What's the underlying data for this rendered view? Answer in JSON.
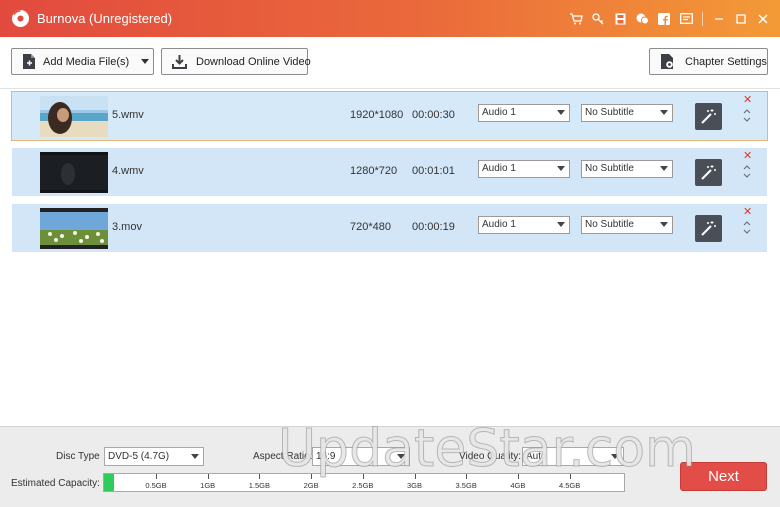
{
  "window": {
    "title": "Burnova (Unregistered)"
  },
  "titlebar_icons": [
    "cart-icon",
    "key-icon",
    "save-icon",
    "chat-icon",
    "facebook-icon",
    "feedback-icon",
    "minimize-icon",
    "maximize-icon",
    "close-icon"
  ],
  "toolbar": {
    "add_media_label": "Add Media File(s)",
    "download_label": "Download Online Video",
    "chapter_label": "Chapter Settings"
  },
  "files": [
    {
      "name": "5.wmv",
      "resolution": "1920*1080",
      "duration": "00:00:30",
      "audio": "Audio 1",
      "subtitle": "No Subtitle",
      "selected": true
    },
    {
      "name": "4.wmv",
      "resolution": "1280*720",
      "duration": "00:01:01",
      "audio": "Audio 1",
      "subtitle": "No Subtitle",
      "selected": false
    },
    {
      "name": "3.mov",
      "resolution": "720*480",
      "duration": "00:00:19",
      "audio": "Audio 1",
      "subtitle": "No Subtitle",
      "selected": false
    }
  ],
  "bottom": {
    "disc_type_label": "Disc Type",
    "disc_type_value": "DVD-5 (4.7G)",
    "aspect_ratio_label": "Aspect Ratio:",
    "aspect_ratio_value": "16:9",
    "video_quality_label": "Video Quality:",
    "video_quality_value": "Auto",
    "capacity_label": "Estimated Capacity:",
    "capacity_fraction": 0.02,
    "capacity_ticks": [
      "0.5GB",
      "1GB",
      "1.5GB",
      "2GB",
      "2.5GB",
      "3GB",
      "3.5GB",
      "4GB",
      "4.5GB"
    ],
    "next_label": "Next"
  },
  "watermark": "UpdateStar.com",
  "colors": {
    "titlebar_start": "#e24a3e",
    "titlebar_end": "#f39a37",
    "row_bg": "#d3e6f7",
    "next_bg": "#e24d48",
    "capacity_fill": "#2ecc5a"
  }
}
